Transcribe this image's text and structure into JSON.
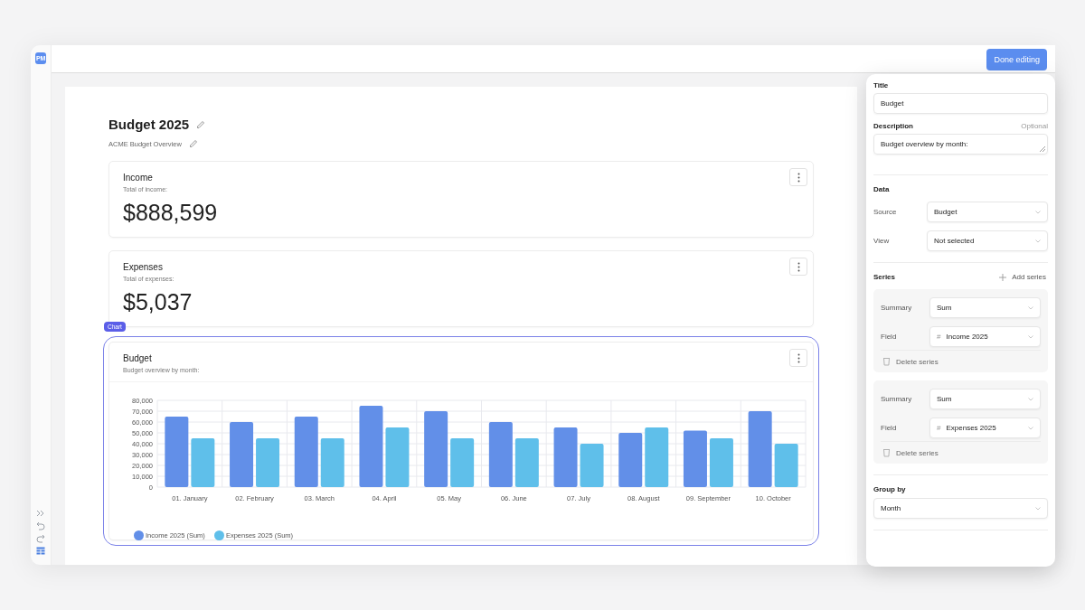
{
  "app": {
    "badge": "PM"
  },
  "toolbar": {
    "done_button": "Done editing"
  },
  "dashboard": {
    "title": "Budget 2025",
    "subtitle": "ACME Budget Overview",
    "cards": [
      {
        "kind": "number",
        "title": "Income",
        "description": "Total of income:",
        "value": "$888,599",
        "selected": false
      },
      {
        "kind": "number",
        "title": "Expenses",
        "description": "Total of expenses:",
        "value": "$5,037",
        "selected": false
      },
      {
        "kind": "chart",
        "title": "Budget",
        "description": "Budget overview by month:",
        "badge": "Chart",
        "selected": true,
        "chart_data": {
          "type": "bar",
          "categories": [
            "01. January",
            "02. February",
            "03. March",
            "04. April",
            "05. May",
            "06. June",
            "07. July",
            "08. August",
            "09. September",
            "10. October"
          ],
          "series": [
            {
              "name": "Income 2025 (Sum)",
              "color": "#628fe8",
              "values": [
                65000,
                60000,
                65000,
                75000,
                70000,
                60000,
                55000,
                50000,
                52000,
                70000
              ]
            },
            {
              "name": "Expenses 2025 (Sum)",
              "color": "#5fbfea",
              "values": [
                45000,
                45000,
                45000,
                55000,
                45000,
                45000,
                40000,
                55000,
                45000,
                40000
              ]
            }
          ],
          "ylim": [
            0,
            80000
          ],
          "grid": true,
          "legend": true,
          "yticks": [
            {
              "value": 0,
              "label": "0"
            },
            {
              "value": 10000,
              "label": "10,000"
            },
            {
              "value": 20000,
              "label": "20,000"
            },
            {
              "value": 30000,
              "label": "30,000"
            },
            {
              "value": 40000,
              "label": "40,000"
            },
            {
              "value": 50000,
              "label": "50,000"
            },
            {
              "value": 60000,
              "label": "60,000"
            },
            {
              "value": 70000,
              "label": "70,000"
            },
            {
              "value": 80000,
              "label": "80,000"
            }
          ]
        }
      }
    ]
  },
  "panel": {
    "title": {
      "label": "Title",
      "value": "Budget"
    },
    "description": {
      "label": "Description",
      "hint": "Optional",
      "value": "Budget overview by month:"
    },
    "data": {
      "heading": "Data",
      "rows": [
        {
          "label": "Source",
          "value": "Budget"
        },
        {
          "label": "View",
          "value": "Not selected"
        }
      ]
    },
    "series": {
      "heading": "Series",
      "add_button": "Add series",
      "items": [
        {
          "rows": [
            {
              "label": "Summary",
              "value": "Sum"
            },
            {
              "label": "Field",
              "prefix": "#",
              "value": "Income 2025"
            }
          ],
          "delete": "Delete series"
        },
        {
          "rows": [
            {
              "label": "Summary",
              "value": "Sum"
            },
            {
              "label": "Field",
              "prefix": "#",
              "value": "Expenses 2025"
            }
          ],
          "delete": "Delete series"
        }
      ]
    },
    "group_by": {
      "label": "Group by",
      "value": "Month"
    }
  }
}
